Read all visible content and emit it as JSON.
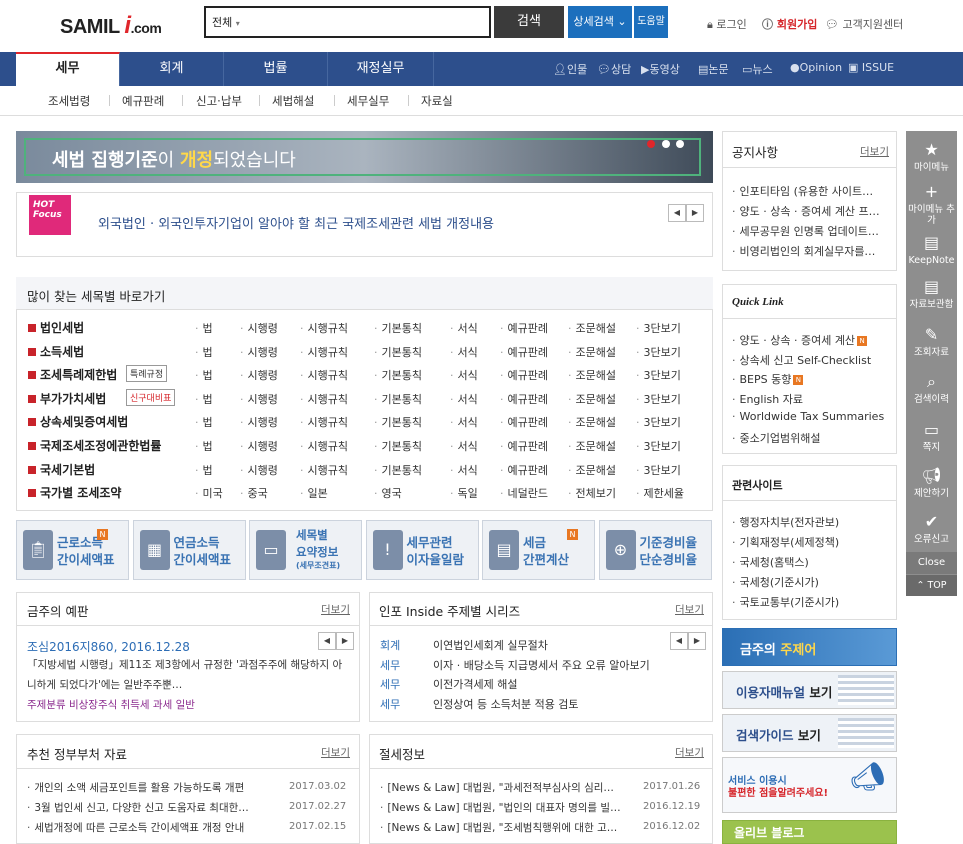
{
  "header": {
    "logo_samil": "SAMIL",
    "logo_i": "i",
    "logo_com": ".com",
    "search_select": "전체",
    "search_button": "검색",
    "advanced_search": "상세검색",
    "help": "도움말",
    "login": "로그인",
    "join": "회원가입",
    "support": "고객지원센터"
  },
  "main_nav": {
    "tabs": [
      "세무",
      "회계",
      "법률",
      "재정실무"
    ],
    "right_links": [
      "인물",
      "상담",
      "동영상",
      "논문",
      "뉴스",
      "Opinion",
      "ISSUE"
    ]
  },
  "sub_nav": [
    "조세법령",
    "예규판례",
    "신고·납부",
    "세법해설",
    "세무실무",
    "자료실"
  ],
  "banner": {
    "part1": "세법 집행기준",
    "part2": "이 ",
    "part3": "개정",
    "part4": "되었습니다"
  },
  "hot_focus": {
    "badge": "HOT Focus",
    "title": "외국법인 · 외국인투자기업이 알아야 할 최근 국제조세관련 세법 개정내용"
  },
  "tax_shortcuts": {
    "title": "많이 찾는 세목별 바로가기",
    "rows": [
      {
        "name": "법인세법",
        "badge": "",
        "links": [
          "법",
          "시행령",
          "시행규칙",
          "기본통칙",
          "서식",
          "예규판례",
          "조문해설",
          "3단보기"
        ]
      },
      {
        "name": "소득세법",
        "badge": "",
        "links": [
          "법",
          "시행령",
          "시행규칙",
          "기본통칙",
          "서식",
          "예규판례",
          "조문해설",
          "3단보기"
        ]
      },
      {
        "name": "조세특례제한법",
        "badge": "특례규정",
        "links": [
          "법",
          "시행령",
          "시행규칙",
          "기본통칙",
          "서식",
          "예규판례",
          "조문해설",
          "3단보기"
        ]
      },
      {
        "name": "부가가치세법",
        "badge": "신구대비표",
        "links": [
          "법",
          "시행령",
          "시행규칙",
          "기본통칙",
          "서식",
          "예규판례",
          "조문해설",
          "3단보기"
        ]
      },
      {
        "name": "상속세및증여세법",
        "badge": "",
        "links": [
          "법",
          "시행령",
          "시행규칙",
          "기본통칙",
          "서식",
          "예규판례",
          "조문해설",
          "3단보기"
        ]
      },
      {
        "name": "국제조세조정에관한법률",
        "badge": "",
        "links": [
          "법",
          "시행령",
          "시행규칙",
          "기본통칙",
          "서식",
          "예규판례",
          "조문해설",
          "3단보기"
        ]
      },
      {
        "name": "국세기본법",
        "badge": "",
        "links": [
          "법",
          "시행령",
          "시행규칙",
          "기본통칙",
          "서식",
          "예규판례",
          "조문해설",
          "3단보기"
        ]
      },
      {
        "name": "국가별 조세조약",
        "badge": "",
        "links": [
          "미국",
          "중국",
          "일본",
          "영국",
          "독일",
          "네덜란드",
          "전체보기",
          "제한세율"
        ]
      }
    ]
  },
  "quick_icons": [
    {
      "line1": "근로소득",
      "line2": "간이세액표",
      "line3": "",
      "new": true
    },
    {
      "line1": "연금소득",
      "line2": "간이세액표",
      "line3": "",
      "new": false
    },
    {
      "line1": "세목별",
      "line2": "요약정보",
      "line3": "(세무조견표)",
      "new": false
    },
    {
      "line1": "세무관련",
      "line2": "이자율일람",
      "line3": "",
      "new": false
    },
    {
      "line1": "세금",
      "line2": "간편계산",
      "line3": "",
      "new": true
    },
    {
      "line1": "기준경비율",
      "line2": "단순경비율",
      "line3": "",
      "new": false
    }
  ],
  "weekly_case": {
    "title": "금주의 예판",
    "more": "더보기",
    "case_no": "조심2016지860, 2016.12.28",
    "desc1": "「지방세법 시행령」제11조 제3항에서 규정한 '과점주주에 해당하지 아",
    "desc2": "니하게 되었다가'에는 일반주주뿐…",
    "tag": "주제분류 비상장주식 취득세 과세 일반"
  },
  "inside_series": {
    "title": "인포 Inside 주제별 시리즈",
    "more": "더보기",
    "items": [
      {
        "cat": "회계",
        "text": "이연법인세회계 실무절차"
      },
      {
        "cat": "세무",
        "text": "이자 · 배당소득 지급명세서 주요 오류 알아보기"
      },
      {
        "cat": "세무",
        "text": "이전가격세제 해설"
      },
      {
        "cat": "세무",
        "text": "인정상여 등 소득처분 적용 검토"
      }
    ]
  },
  "gov_docs": {
    "title": "추천 정부부처 자료",
    "more": "더보기",
    "items": [
      {
        "text": "개인의 소액 세금포인트를 활용 가능하도록 개편",
        "date": "2017.03.02"
      },
      {
        "text": "3월 법인세 신고, 다양한 신고 도움자료 최대한…",
        "date": "2017.02.27"
      },
      {
        "text": "세법개정에 따른 근로소득 간이세액표 개정 안내",
        "date": "2017.02.15"
      }
    ]
  },
  "tax_saving": {
    "title": "절세정보",
    "more": "더보기",
    "items": [
      {
        "text": "[News & Law] 대법원, \"과세전적부심사의 심리…",
        "date": "2017.01.26"
      },
      {
        "text": "[News & Law] 대법원, \"법인의 대표자 명의를 빌…",
        "date": "2016.12.19"
      },
      {
        "text": "[News & Law] 대법원, \"조세범칙행위에 대한 고…",
        "date": "2016.12.02"
      }
    ]
  },
  "notice": {
    "title": "공지사항",
    "more": "더보기",
    "items": [
      "인포티타임 (유용한 사이트…",
      "양도 · 상속 · 증여세 계산 프…",
      "세무공무원 인명록 업데이트…",
      "비영리법인의 회계실무자를…"
    ]
  },
  "quick_link": {
    "title": "Quick Link",
    "items": [
      {
        "text": "양도 · 상속 · 증여세 계산",
        "new": true
      },
      {
        "text": "상속세 신고 Self-Checklist",
        "new": false
      },
      {
        "text": "BEPS 동향",
        "new": true
      },
      {
        "text": "English 자료",
        "new": false
      },
      {
        "text": "Worldwide Tax Summaries",
        "new": false
      },
      {
        "text": "중소기업범위해설",
        "new": false
      }
    ]
  },
  "related_sites": {
    "title": "관련사이트",
    "items": [
      "행정자치부(전자관보)",
      "기획재정부(세제정책)",
      "국세청(홈택스)",
      "국세청(기준시가)",
      "국토교통부(기준시가)"
    ]
  },
  "right_banners": {
    "weekly_theme_a": "금주의 ",
    "weekly_theme_b": "주제어",
    "manual_a": "이용자매뉴얼",
    "manual_b": " 보기",
    "guide_a": "검색가이드",
    "guide_b": " 보기",
    "service_line1": "서비스 이용시",
    "service_line2": "불편한 점을알려주세요!",
    "blog": "올리브 블로그"
  },
  "quick_side": {
    "items": [
      "마이메뉴",
      "마이메뉴 추가",
      "KeepNote",
      "자료보관함",
      "조회자료",
      "검색이력",
      "쪽지",
      "제안하기",
      "오류신고"
    ],
    "close": "Close",
    "top": "TOP"
  },
  "colors": {
    "nav": "#2d4f8c",
    "accent_red": "#e0262b",
    "link_blue": "#3a73b3",
    "new_orange": "#e87722"
  }
}
